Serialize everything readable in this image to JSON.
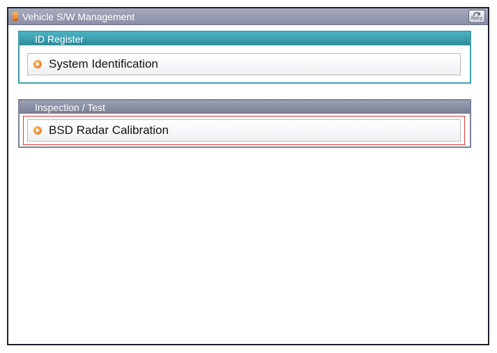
{
  "window": {
    "title": "Vehicle S/W Management",
    "retry_label": "Retry"
  },
  "sections": [
    {
      "header": "ID Register",
      "items": [
        {
          "label": "System Identification"
        }
      ]
    },
    {
      "header": "Inspection / Test",
      "items": [
        {
          "label": "BSD Radar Calibration",
          "selected": true
        }
      ]
    }
  ],
  "colors": {
    "titlebar": "#8a8fa6",
    "id_register_accent": "#3e9fae",
    "inspection_accent": "#7d8196",
    "selection_outline": "#e0342f",
    "bullet": "#e06a12"
  },
  "icons": {
    "title": "app-icon",
    "retry": "retry-icon",
    "item_bullet": "arrow-bullet-icon"
  }
}
